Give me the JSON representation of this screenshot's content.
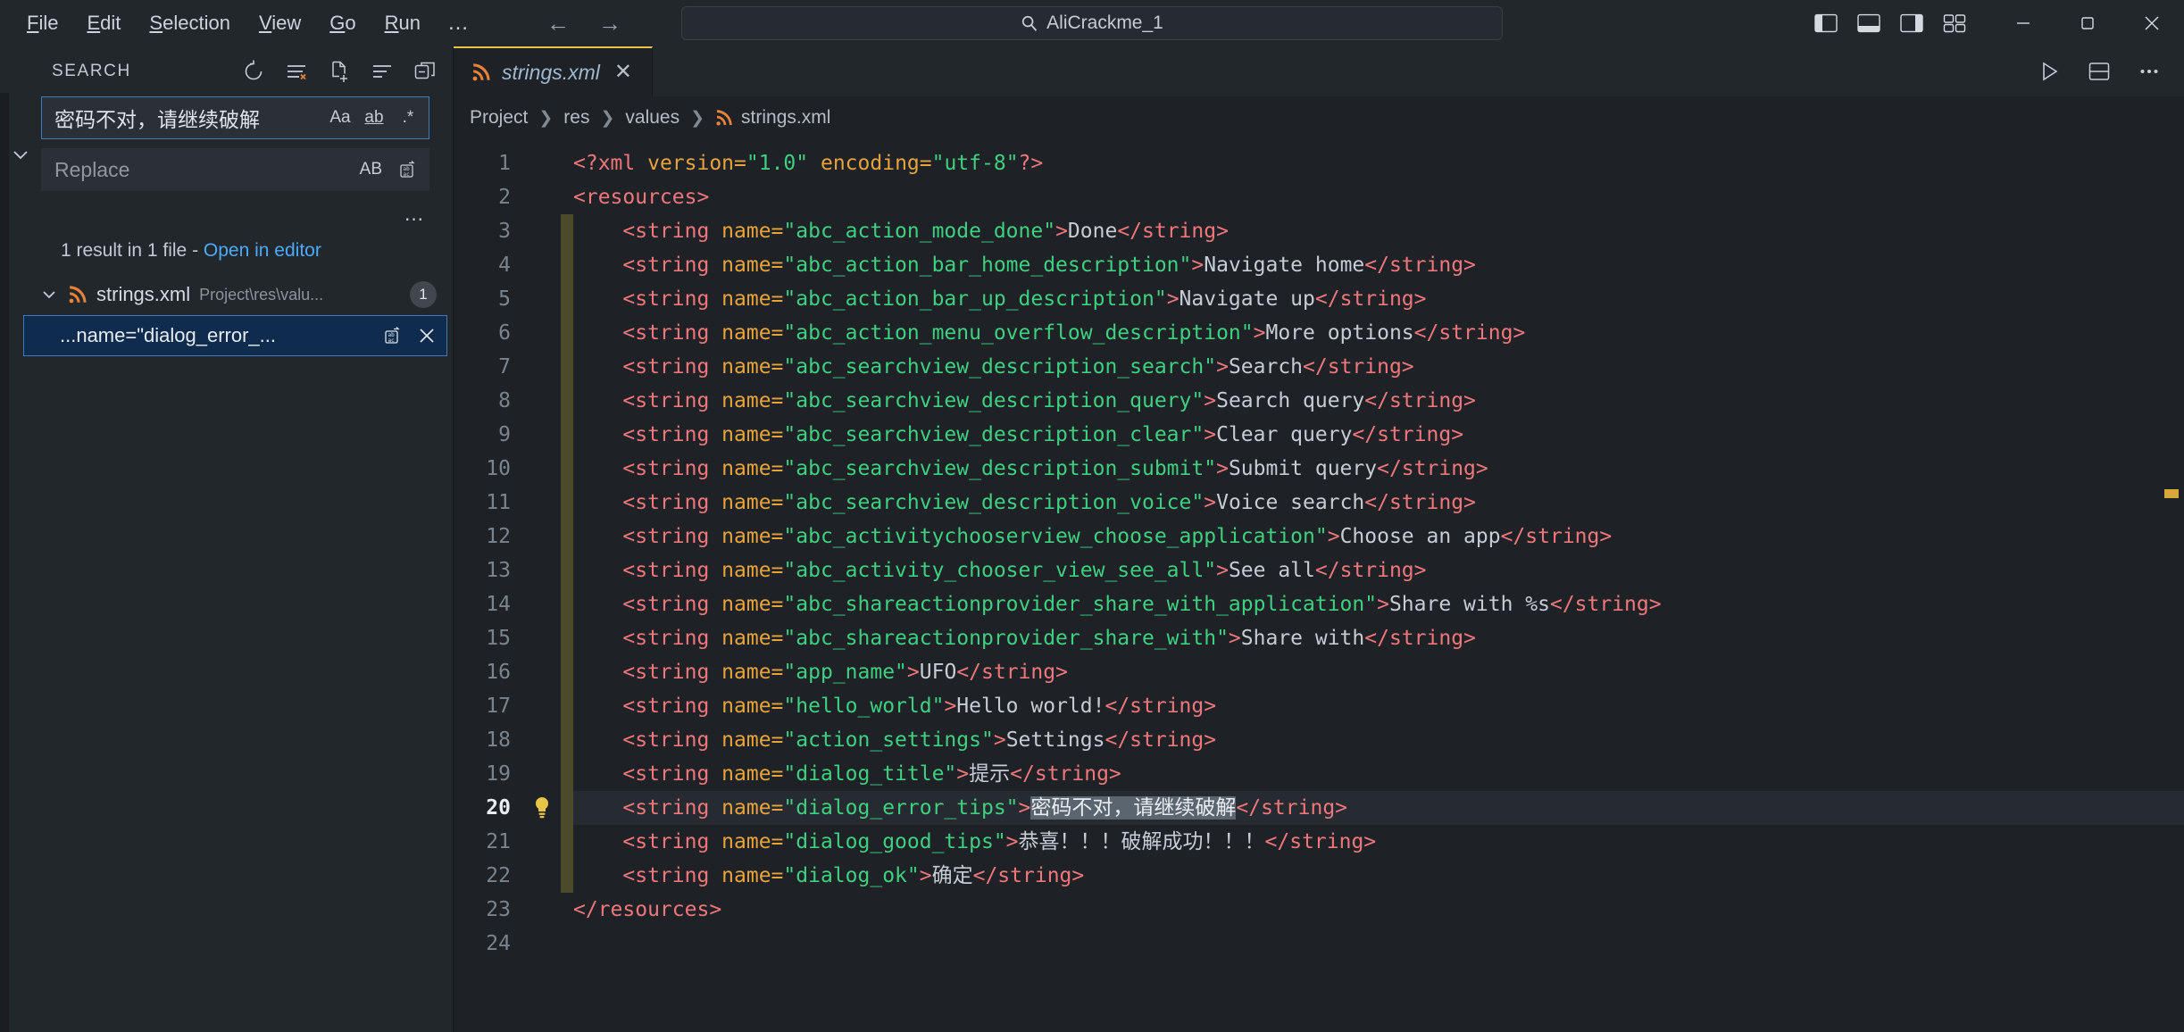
{
  "titlebar": {
    "menu": [
      {
        "label": "File",
        "mnemonic": "F"
      },
      {
        "label": "Edit",
        "mnemonic": "E"
      },
      {
        "label": "Selection",
        "mnemonic": "S"
      },
      {
        "label": "View",
        "mnemonic": "V"
      },
      {
        "label": "Go",
        "mnemonic": "G"
      },
      {
        "label": "Run",
        "mnemonic": "R"
      }
    ],
    "overflow_label": "…",
    "back_icon": "arrow-left-icon",
    "forward_icon": "arrow-right-icon",
    "search": {
      "value": "AliCrackme_1",
      "icon": "search-icon"
    },
    "layout_icons": [
      "toggle-primary-sidebar-icon",
      "toggle-panel-icon",
      "toggle-secondary-sidebar-icon",
      "customize-layout-icon"
    ],
    "window_controls": [
      "minimize-icon",
      "maximize-icon",
      "close-icon"
    ]
  },
  "sidebar": {
    "title": "SEARCH",
    "actions": [
      "refresh-icon",
      "clear-search-results-icon",
      "new-search-editor-icon",
      "view-as-list-icon",
      "collapse-all-icon"
    ],
    "search_input": {
      "value": "密码不对，请继续破解",
      "toggles": [
        {
          "name": "match-case-toggle",
          "label": "Aa"
        },
        {
          "name": "match-whole-word-toggle",
          "label": "ab"
        },
        {
          "name": "use-regex-toggle",
          "label": ".*"
        }
      ]
    },
    "replace_input": {
      "placeholder": "Replace",
      "value": "",
      "toggles": [
        {
          "name": "preserve-case-toggle",
          "label": "AB"
        },
        {
          "name": "replace-all-icon",
          "label": ""
        }
      ]
    },
    "toggle_details_label": "…",
    "results": {
      "summary_prefix": "1 result in 1 file - ",
      "open_in_editor_label": "Open in editor",
      "files": [
        {
          "name": "strings.xml",
          "path": "Project\\res\\valu...",
          "count": "1",
          "icon": "xml-file-icon",
          "matches": [
            {
              "text": "...name=\"dialog_error_...",
              "actions": [
                "replace-icon",
                "dismiss-icon"
              ]
            }
          ]
        }
      ]
    }
  },
  "editor": {
    "tabs": [
      {
        "label": "strings.xml",
        "icon": "xml-file-icon",
        "close_icon": "close-icon",
        "active": true
      }
    ],
    "tab_actions": [
      "run-icon",
      "split-editor-down-icon",
      "more-actions-icon"
    ],
    "breadcrumb": [
      {
        "label": "Project",
        "icon": ""
      },
      {
        "label": "res",
        "icon": ""
      },
      {
        "label": "values",
        "icon": ""
      },
      {
        "label": "strings.xml",
        "icon": "xml-file-icon"
      }
    ],
    "active_line": 20,
    "folded_range": {
      "from": 3,
      "to": 22
    },
    "lightbulb_line": 20,
    "lines": [
      {
        "n": 1,
        "tokens": [
          {
            "t": "<?xml ",
            "c": "pi"
          },
          {
            "t": "version=",
            "c": "attr"
          },
          {
            "t": "\"1.0\"",
            "c": "str"
          },
          {
            "t": " ",
            "c": "txt"
          },
          {
            "t": "encoding=",
            "c": "attr"
          },
          {
            "t": "\"utf-8\"",
            "c": "str"
          },
          {
            "t": "?>",
            "c": "pi"
          }
        ]
      },
      {
        "n": 2,
        "tokens": [
          {
            "t": "<resources>",
            "c": "tag"
          }
        ]
      },
      {
        "n": 3,
        "tokens": [
          {
            "t": "    <string ",
            "c": "tag"
          },
          {
            "t": "name=",
            "c": "attr"
          },
          {
            "t": "\"abc_action_mode_done\"",
            "c": "str"
          },
          {
            "t": ">",
            "c": "tag"
          },
          {
            "t": "Done",
            "c": "txt"
          },
          {
            "t": "</string>",
            "c": "tag"
          }
        ]
      },
      {
        "n": 4,
        "tokens": [
          {
            "t": "    <string ",
            "c": "tag"
          },
          {
            "t": "name=",
            "c": "attr"
          },
          {
            "t": "\"abc_action_bar_home_description\"",
            "c": "str"
          },
          {
            "t": ">",
            "c": "tag"
          },
          {
            "t": "Navigate home",
            "c": "txt"
          },
          {
            "t": "</string>",
            "c": "tag"
          }
        ]
      },
      {
        "n": 5,
        "tokens": [
          {
            "t": "    <string ",
            "c": "tag"
          },
          {
            "t": "name=",
            "c": "attr"
          },
          {
            "t": "\"abc_action_bar_up_description\"",
            "c": "str"
          },
          {
            "t": ">",
            "c": "tag"
          },
          {
            "t": "Navigate up",
            "c": "txt"
          },
          {
            "t": "</string>",
            "c": "tag"
          }
        ]
      },
      {
        "n": 6,
        "tokens": [
          {
            "t": "    <string ",
            "c": "tag"
          },
          {
            "t": "name=",
            "c": "attr"
          },
          {
            "t": "\"abc_action_menu_overflow_description\"",
            "c": "str"
          },
          {
            "t": ">",
            "c": "tag"
          },
          {
            "t": "More options",
            "c": "txt"
          },
          {
            "t": "</string>",
            "c": "tag"
          }
        ]
      },
      {
        "n": 7,
        "tokens": [
          {
            "t": "    <string ",
            "c": "tag"
          },
          {
            "t": "name=",
            "c": "attr"
          },
          {
            "t": "\"abc_searchview_description_search\"",
            "c": "str"
          },
          {
            "t": ">",
            "c": "tag"
          },
          {
            "t": "Search",
            "c": "txt"
          },
          {
            "t": "</string>",
            "c": "tag"
          }
        ]
      },
      {
        "n": 8,
        "tokens": [
          {
            "t": "    <string ",
            "c": "tag"
          },
          {
            "t": "name=",
            "c": "attr"
          },
          {
            "t": "\"abc_searchview_description_query\"",
            "c": "str"
          },
          {
            "t": ">",
            "c": "tag"
          },
          {
            "t": "Search query",
            "c": "txt"
          },
          {
            "t": "</string>",
            "c": "tag"
          }
        ]
      },
      {
        "n": 9,
        "tokens": [
          {
            "t": "    <string ",
            "c": "tag"
          },
          {
            "t": "name=",
            "c": "attr"
          },
          {
            "t": "\"abc_searchview_description_clear\"",
            "c": "str"
          },
          {
            "t": ">",
            "c": "tag"
          },
          {
            "t": "Clear query",
            "c": "txt"
          },
          {
            "t": "</string>",
            "c": "tag"
          }
        ]
      },
      {
        "n": 10,
        "tokens": [
          {
            "t": "    <string ",
            "c": "tag"
          },
          {
            "t": "name=",
            "c": "attr"
          },
          {
            "t": "\"abc_searchview_description_submit\"",
            "c": "str"
          },
          {
            "t": ">",
            "c": "tag"
          },
          {
            "t": "Submit query",
            "c": "txt"
          },
          {
            "t": "</string>",
            "c": "tag"
          }
        ]
      },
      {
        "n": 11,
        "tokens": [
          {
            "t": "    <string ",
            "c": "tag"
          },
          {
            "t": "name=",
            "c": "attr"
          },
          {
            "t": "\"abc_searchview_description_voice\"",
            "c": "str"
          },
          {
            "t": ">",
            "c": "tag"
          },
          {
            "t": "Voice search",
            "c": "txt"
          },
          {
            "t": "</string>",
            "c": "tag"
          }
        ]
      },
      {
        "n": 12,
        "tokens": [
          {
            "t": "    <string ",
            "c": "tag"
          },
          {
            "t": "name=",
            "c": "attr"
          },
          {
            "t": "\"abc_activitychooserview_choose_application\"",
            "c": "str"
          },
          {
            "t": ">",
            "c": "tag"
          },
          {
            "t": "Choose an app",
            "c": "txt"
          },
          {
            "t": "</string>",
            "c": "tag"
          }
        ]
      },
      {
        "n": 13,
        "tokens": [
          {
            "t": "    <string ",
            "c": "tag"
          },
          {
            "t": "name=",
            "c": "attr"
          },
          {
            "t": "\"abc_activity_chooser_view_see_all\"",
            "c": "str"
          },
          {
            "t": ">",
            "c": "tag"
          },
          {
            "t": "See all",
            "c": "txt"
          },
          {
            "t": "</string>",
            "c": "tag"
          }
        ]
      },
      {
        "n": 14,
        "tokens": [
          {
            "t": "    <string ",
            "c": "tag"
          },
          {
            "t": "name=",
            "c": "attr"
          },
          {
            "t": "\"abc_shareactionprovider_share_with_application\"",
            "c": "str"
          },
          {
            "t": ">",
            "c": "tag"
          },
          {
            "t": "Share with %s",
            "c": "txt"
          },
          {
            "t": "</string>",
            "c": "tag"
          }
        ]
      },
      {
        "n": 15,
        "tokens": [
          {
            "t": "    <string ",
            "c": "tag"
          },
          {
            "t": "name=",
            "c": "attr"
          },
          {
            "t": "\"abc_shareactionprovider_share_with\"",
            "c": "str"
          },
          {
            "t": ">",
            "c": "tag"
          },
          {
            "t": "Share with",
            "c": "txt"
          },
          {
            "t": "</string>",
            "c": "tag"
          }
        ]
      },
      {
        "n": 16,
        "tokens": [
          {
            "t": "    <string ",
            "c": "tag"
          },
          {
            "t": "name=",
            "c": "attr"
          },
          {
            "t": "\"app_name\"",
            "c": "str"
          },
          {
            "t": ">",
            "c": "tag"
          },
          {
            "t": "UFO",
            "c": "txt"
          },
          {
            "t": "</string>",
            "c": "tag"
          }
        ]
      },
      {
        "n": 17,
        "tokens": [
          {
            "t": "    <string ",
            "c": "tag"
          },
          {
            "t": "name=",
            "c": "attr"
          },
          {
            "t": "\"hello_world\"",
            "c": "str"
          },
          {
            "t": ">",
            "c": "tag"
          },
          {
            "t": "Hello world!",
            "c": "txt"
          },
          {
            "t": "</string>",
            "c": "tag"
          }
        ]
      },
      {
        "n": 18,
        "tokens": [
          {
            "t": "    <string ",
            "c": "tag"
          },
          {
            "t": "name=",
            "c": "attr"
          },
          {
            "t": "\"action_settings\"",
            "c": "str"
          },
          {
            "t": ">",
            "c": "tag"
          },
          {
            "t": "Settings",
            "c": "txt"
          },
          {
            "t": "</string>",
            "c": "tag"
          }
        ]
      },
      {
        "n": 19,
        "tokens": [
          {
            "t": "    <string ",
            "c": "tag"
          },
          {
            "t": "name=",
            "c": "attr"
          },
          {
            "t": "\"dialog_title\"",
            "c": "str"
          },
          {
            "t": ">",
            "c": "tag"
          },
          {
            "t": "提示",
            "c": "txt"
          },
          {
            "t": "</string>",
            "c": "tag"
          }
        ]
      },
      {
        "n": 20,
        "tokens": [
          {
            "t": "    <string ",
            "c": "tag"
          },
          {
            "t": "name=",
            "c": "attr"
          },
          {
            "t": "\"dialog_error_tips\"",
            "c": "str"
          },
          {
            "t": ">",
            "c": "tag"
          },
          {
            "t": "密码不对，请继续破解",
            "c": "sel"
          },
          {
            "t": "</string>",
            "c": "tag"
          }
        ]
      },
      {
        "n": 21,
        "tokens": [
          {
            "t": "    <string ",
            "c": "tag"
          },
          {
            "t": "name=",
            "c": "attr"
          },
          {
            "t": "\"dialog_good_tips\"",
            "c": "str"
          },
          {
            "t": ">",
            "c": "tag"
          },
          {
            "t": "恭喜！！！破解成功！！！",
            "c": "txt"
          },
          {
            "t": "</string>",
            "c": "tag"
          }
        ]
      },
      {
        "n": 22,
        "tokens": [
          {
            "t": "    <string ",
            "c": "tag"
          },
          {
            "t": "name=",
            "c": "attr"
          },
          {
            "t": "\"dialog_ok\"",
            "c": "str"
          },
          {
            "t": ">",
            "c": "tag"
          },
          {
            "t": "确定",
            "c": "txt"
          },
          {
            "t": "</string>",
            "c": "tag"
          }
        ]
      },
      {
        "n": 23,
        "tokens": [
          {
            "t": "</resources>",
            "c": "tag"
          }
        ]
      },
      {
        "n": 24,
        "tokens": []
      }
    ]
  },
  "colors": {
    "accent": "#4daafc",
    "tab_active_border": "#e8c547",
    "xml_icon": "#e8833a",
    "tag": "#f2777a",
    "attr": "#e8a33d",
    "string": "#3fd07f",
    "selection": "#5b6570",
    "fold_marker": "#4b4a2a"
  }
}
